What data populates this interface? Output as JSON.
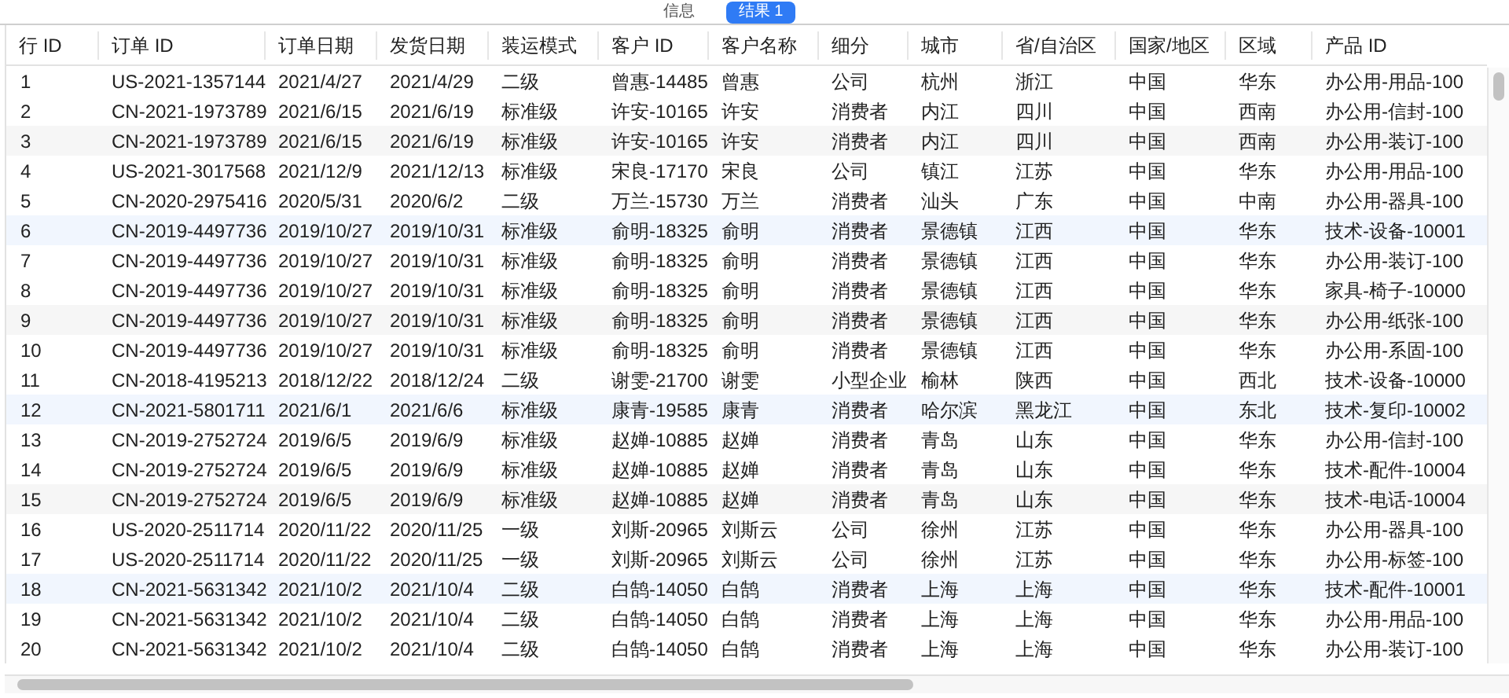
{
  "tabs": [
    {
      "label": "信息",
      "selected": false
    },
    {
      "label": "结果 1",
      "selected": true
    }
  ],
  "table": {
    "columns": [
      "行 ID",
      "订单 ID",
      "订单日期",
      "发货日期",
      "装运模式",
      "客户 ID",
      "客户名称",
      "细分",
      "城市",
      "省/自治区",
      "国家/地区",
      "区域",
      "产品 ID"
    ],
    "rows": [
      {
        "kind": "plain",
        "cells": [
          "1",
          "US-2021-1357144",
          "2021/4/27",
          "2021/4/29",
          "二级",
          "曾惠-14485",
          "曾惠",
          "公司",
          "杭州",
          "浙江",
          "中国",
          "华东",
          "办公用-用品-100"
        ]
      },
      {
        "kind": "plain",
        "cells": [
          "2",
          "CN-2021-1973789",
          "2021/6/15",
          "2021/6/19",
          "标准级",
          "许安-10165",
          "许安",
          "消费者",
          "内江",
          "四川",
          "中国",
          "西南",
          "办公用-信封-100"
        ]
      },
      {
        "kind": "gray",
        "cells": [
          "3",
          "CN-2021-1973789",
          "2021/6/15",
          "2021/6/19",
          "标准级",
          "许安-10165",
          "许安",
          "消费者",
          "内江",
          "四川",
          "中国",
          "西南",
          "办公用-装订-100"
        ]
      },
      {
        "kind": "plain",
        "cells": [
          "4",
          "US-2021-3017568",
          "2021/12/9",
          "2021/12/13",
          "标准级",
          "宋良-17170",
          "宋良",
          "公司",
          "镇江",
          "江苏",
          "中国",
          "华东",
          "办公用-用品-100"
        ]
      },
      {
        "kind": "plain",
        "cells": [
          "5",
          "CN-2020-2975416",
          "2020/5/31",
          "2020/6/2",
          "二级",
          "万兰-15730",
          "万兰",
          "消费者",
          "汕头",
          "广东",
          "中国",
          "中南",
          "办公用-器具-100"
        ]
      },
      {
        "kind": "blue",
        "cells": [
          "6",
          "CN-2019-4497736",
          "2019/10/27",
          "2019/10/31",
          "标准级",
          "俞明-18325",
          "俞明",
          "消费者",
          "景德镇",
          "江西",
          "中国",
          "华东",
          "技术-设备-10001"
        ]
      },
      {
        "kind": "plain",
        "cells": [
          "7",
          "CN-2019-4497736",
          "2019/10/27",
          "2019/10/31",
          "标准级",
          "俞明-18325",
          "俞明",
          "消费者",
          "景德镇",
          "江西",
          "中国",
          "华东",
          "办公用-装订-100"
        ]
      },
      {
        "kind": "plain",
        "cells": [
          "8",
          "CN-2019-4497736",
          "2019/10/27",
          "2019/10/31",
          "标准级",
          "俞明-18325",
          "俞明",
          "消费者",
          "景德镇",
          "江西",
          "中国",
          "华东",
          "家具-椅子-10000"
        ]
      },
      {
        "kind": "gray",
        "cells": [
          "9",
          "CN-2019-4497736",
          "2019/10/27",
          "2019/10/31",
          "标准级",
          "俞明-18325",
          "俞明",
          "消费者",
          "景德镇",
          "江西",
          "中国",
          "华东",
          "办公用-纸张-100"
        ]
      },
      {
        "kind": "plain",
        "cells": [
          "10",
          "CN-2019-4497736",
          "2019/10/27",
          "2019/10/31",
          "标准级",
          "俞明-18325",
          "俞明",
          "消费者",
          "景德镇",
          "江西",
          "中国",
          "华东",
          "办公用-系固-100"
        ]
      },
      {
        "kind": "plain",
        "cells": [
          "11",
          "CN-2018-4195213",
          "2018/12/22",
          "2018/12/24",
          "二级",
          "谢雯-21700",
          "谢雯",
          "小型企业",
          "榆林",
          "陕西",
          "中国",
          "西北",
          "技术-设备-10000"
        ]
      },
      {
        "kind": "blue",
        "cells": [
          "12",
          "CN-2021-5801711",
          "2021/6/1",
          "2021/6/6",
          "标准级",
          "康青-19585",
          "康青",
          "消费者",
          "哈尔滨",
          "黑龙江",
          "中国",
          "东北",
          "技术-复印-10002"
        ]
      },
      {
        "kind": "plain",
        "cells": [
          "13",
          "CN-2019-2752724",
          "2019/6/5",
          "2019/6/9",
          "标准级",
          "赵婵-10885",
          "赵婵",
          "消费者",
          "青岛",
          "山东",
          "中国",
          "华东",
          "办公用-信封-100"
        ]
      },
      {
        "kind": "plain",
        "cells": [
          "14",
          "CN-2019-2752724",
          "2019/6/5",
          "2019/6/9",
          "标准级",
          "赵婵-10885",
          "赵婵",
          "消费者",
          "青岛",
          "山东",
          "中国",
          "华东",
          "技术-配件-10004"
        ]
      },
      {
        "kind": "gray",
        "cells": [
          "15",
          "CN-2019-2752724",
          "2019/6/5",
          "2019/6/9",
          "标准级",
          "赵婵-10885",
          "赵婵",
          "消费者",
          "青岛",
          "山东",
          "中国",
          "华东",
          "技术-电话-10004"
        ]
      },
      {
        "kind": "plain",
        "cells": [
          "16",
          "US-2020-2511714",
          "2020/11/22",
          "2020/11/25",
          "一级",
          "刘斯-20965",
          "刘斯云",
          "公司",
          "徐州",
          "江苏",
          "中国",
          "华东",
          "办公用-器具-100"
        ]
      },
      {
        "kind": "plain",
        "cells": [
          "17",
          "US-2020-2511714",
          "2020/11/22",
          "2020/11/25",
          "一级",
          "刘斯-20965",
          "刘斯云",
          "公司",
          "徐州",
          "江苏",
          "中国",
          "华东",
          "办公用-标签-100"
        ]
      },
      {
        "kind": "blue",
        "cells": [
          "18",
          "CN-2021-5631342",
          "2021/10/2",
          "2021/10/4",
          "二级",
          "白鹄-14050",
          "白鹄",
          "消费者",
          "上海",
          "上海",
          "中国",
          "华东",
          "技术-配件-10001"
        ]
      },
      {
        "kind": "plain",
        "cells": [
          "19",
          "CN-2021-5631342",
          "2021/10/2",
          "2021/10/4",
          "二级",
          "白鹄-14050",
          "白鹄",
          "消费者",
          "上海",
          "上海",
          "中国",
          "华东",
          "办公用-用品-100"
        ]
      },
      {
        "kind": "plain",
        "cells": [
          "20",
          "CN-2021-5631342",
          "2021/10/2",
          "2021/10/4",
          "二级",
          "白鹄-14050",
          "白鹄",
          "消费者",
          "上海",
          "上海",
          "中国",
          "华东",
          "办公用-装订-100"
        ]
      }
    ]
  }
}
